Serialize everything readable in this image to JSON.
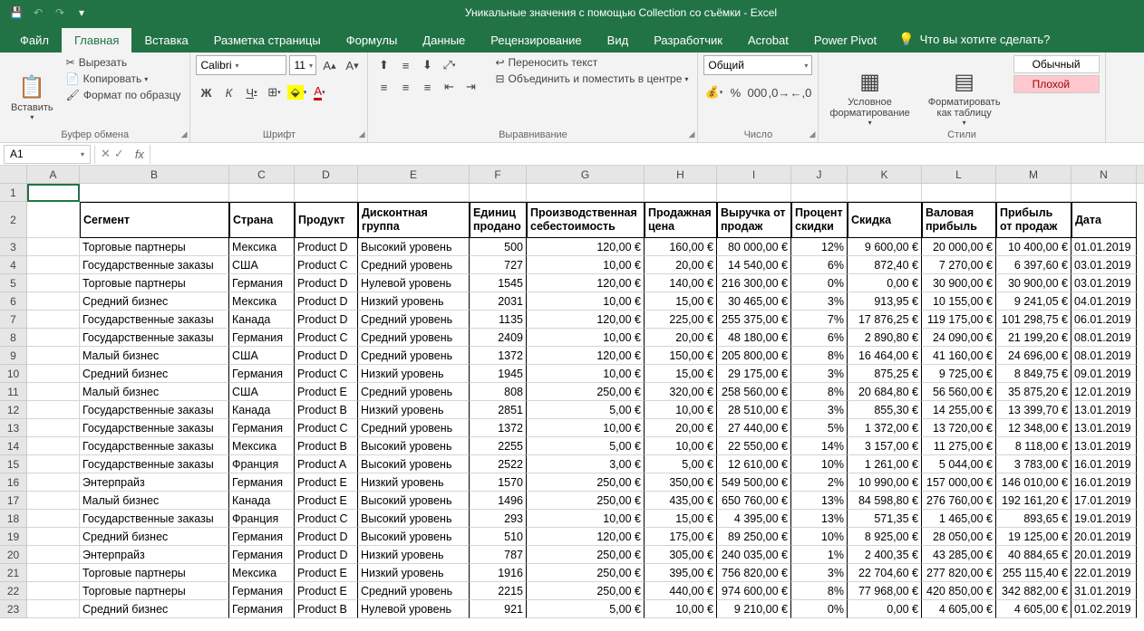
{
  "title": "Уникальные значения с помощью Collection со съёмки  -  Excel",
  "tabs": [
    "Файл",
    "Главная",
    "Вставка",
    "Разметка страницы",
    "Формулы",
    "Данные",
    "Рецензирование",
    "Вид",
    "Разработчик",
    "Acrobat",
    "Power Pivot"
  ],
  "tell_me": "Что вы хотите сделать?",
  "clipboard": {
    "paste": "Вставить",
    "cut": "Вырезать",
    "copy": "Копировать",
    "format_painter": "Формат по образцу",
    "label": "Буфер обмена"
  },
  "font": {
    "name": "Calibri",
    "size": "11",
    "label": "Шрифт"
  },
  "alignment": {
    "wrap": "Переносить текст",
    "merge": "Объединить и поместить в центре",
    "label": "Выравнивание"
  },
  "number": {
    "format": "Общий",
    "label": "Число"
  },
  "styles": {
    "conditional": "Условное\nформатирование",
    "as_table": "Форматировать\nкак таблицу",
    "normal": "Обычный",
    "bad": "Плохой",
    "label": "Стили"
  },
  "name_box": "A1",
  "headers": [
    "Сегмент",
    "Страна",
    "Продукт",
    "Дисконтная группа",
    "Единиц продано",
    "Производственная себестоимость",
    "Продажная цена",
    "Выручка от продаж",
    "Процент скидки",
    "Скидка",
    "Валовая прибыль",
    "Прибыль от продаж",
    "Дата"
  ],
  "col_letters": [
    "A",
    "B",
    "C",
    "D",
    "E",
    "F",
    "G",
    "H",
    "I",
    "J",
    "K",
    "L",
    "M",
    "N"
  ],
  "rows": [
    {
      "n": 3,
      "d": [
        "Торговые партнеры",
        "Мексика",
        "Product D",
        "Высокий уровень",
        "500",
        "120,00 €",
        "160,00 €",
        "80 000,00 €",
        "12%",
        "9 600,00 €",
        "20 000,00 €",
        "10 400,00 €",
        "01.01.2019"
      ]
    },
    {
      "n": 4,
      "d": [
        "Государственные заказы",
        "США",
        "Product C",
        "Средний уровень",
        "727",
        "10,00 €",
        "20,00 €",
        "14 540,00 €",
        "6%",
        "872,40 €",
        "7 270,00 €",
        "6 397,60 €",
        "03.01.2019"
      ]
    },
    {
      "n": 5,
      "d": [
        "Торговые партнеры",
        "Германия",
        "Product D",
        "Нулевой уровень",
        "1545",
        "120,00 €",
        "140,00 €",
        "216 300,00 €",
        "0%",
        "0,00 €",
        "30 900,00 €",
        "30 900,00 €",
        "03.01.2019"
      ]
    },
    {
      "n": 6,
      "d": [
        "Средний бизнес",
        "Мексика",
        "Product D",
        "Низкий уровень",
        "2031",
        "10,00 €",
        "15,00 €",
        "30 465,00 €",
        "3%",
        "913,95 €",
        "10 155,00 €",
        "9 241,05 €",
        "04.01.2019"
      ]
    },
    {
      "n": 7,
      "d": [
        "Государственные заказы",
        "Канада",
        "Product D",
        "Средний уровень",
        "1135",
        "120,00 €",
        "225,00 €",
        "255 375,00 €",
        "7%",
        "17 876,25 €",
        "119 175,00 €",
        "101 298,75 €",
        "06.01.2019"
      ]
    },
    {
      "n": 8,
      "d": [
        "Государственные заказы",
        "Германия",
        "Product C",
        "Средний уровень",
        "2409",
        "10,00 €",
        "20,00 €",
        "48 180,00 €",
        "6%",
        "2 890,80 €",
        "24 090,00 €",
        "21 199,20 €",
        "08.01.2019"
      ]
    },
    {
      "n": 9,
      "d": [
        "Малый бизнес",
        "США",
        "Product D",
        "Средний уровень",
        "1372",
        "120,00 €",
        "150,00 €",
        "205 800,00 €",
        "8%",
        "16 464,00 €",
        "41 160,00 €",
        "24 696,00 €",
        "08.01.2019"
      ]
    },
    {
      "n": 10,
      "d": [
        "Средний бизнес",
        "Германия",
        "Product C",
        "Низкий уровень",
        "1945",
        "10,00 €",
        "15,00 €",
        "29 175,00 €",
        "3%",
        "875,25 €",
        "9 725,00 €",
        "8 849,75 €",
        "09.01.2019"
      ]
    },
    {
      "n": 11,
      "d": [
        "Малый бизнес",
        "США",
        "Product E",
        "Средний уровень",
        "808",
        "250,00 €",
        "320,00 €",
        "258 560,00 €",
        "8%",
        "20 684,80 €",
        "56 560,00 €",
        "35 875,20 €",
        "12.01.2019"
      ]
    },
    {
      "n": 12,
      "d": [
        "Государственные заказы",
        "Канада",
        "Product B",
        "Низкий уровень",
        "2851",
        "5,00 €",
        "10,00 €",
        "28 510,00 €",
        "3%",
        "855,30 €",
        "14 255,00 €",
        "13 399,70 €",
        "13.01.2019"
      ]
    },
    {
      "n": 13,
      "d": [
        "Государственные заказы",
        "Германия",
        "Product C",
        "Средний уровень",
        "1372",
        "10,00 €",
        "20,00 €",
        "27 440,00 €",
        "5%",
        "1 372,00 €",
        "13 720,00 €",
        "12 348,00 €",
        "13.01.2019"
      ]
    },
    {
      "n": 14,
      "d": [
        "Государственные заказы",
        "Мексика",
        "Product B",
        "Высокий уровень",
        "2255",
        "5,00 €",
        "10,00 €",
        "22 550,00 €",
        "14%",
        "3 157,00 €",
        "11 275,00 €",
        "8 118,00 €",
        "13.01.2019"
      ]
    },
    {
      "n": 15,
      "d": [
        "Государственные заказы",
        "Франция",
        "Product A",
        "Высокий уровень",
        "2522",
        "3,00 €",
        "5,00 €",
        "12 610,00 €",
        "10%",
        "1 261,00 €",
        "5 044,00 €",
        "3 783,00 €",
        "16.01.2019"
      ]
    },
    {
      "n": 16,
      "d": [
        "Энтерпрайз",
        "Германия",
        "Product E",
        "Низкий уровень",
        "1570",
        "250,00 €",
        "350,00 €",
        "549 500,00 €",
        "2%",
        "10 990,00 €",
        "157 000,00 €",
        "146 010,00 €",
        "16.01.2019"
      ]
    },
    {
      "n": 17,
      "d": [
        "Малый бизнес",
        "Канада",
        "Product E",
        "Высокий уровень",
        "1496",
        "250,00 €",
        "435,00 €",
        "650 760,00 €",
        "13%",
        "84 598,80 €",
        "276 760,00 €",
        "192 161,20 €",
        "17.01.2019"
      ]
    },
    {
      "n": 18,
      "d": [
        "Государственные заказы",
        "Франция",
        "Product C",
        "Высокий уровень",
        "293",
        "10,00 €",
        "15,00 €",
        "4 395,00 €",
        "13%",
        "571,35 €",
        "1 465,00 €",
        "893,65 €",
        "19.01.2019"
      ]
    },
    {
      "n": 19,
      "d": [
        "Средний бизнес",
        "Германия",
        "Product D",
        "Высокий уровень",
        "510",
        "120,00 €",
        "175,00 €",
        "89 250,00 €",
        "10%",
        "8 925,00 €",
        "28 050,00 €",
        "19 125,00 €",
        "20.01.2019"
      ]
    },
    {
      "n": 20,
      "d": [
        "Энтерпрайз",
        "Германия",
        "Product D",
        "Низкий уровень",
        "787",
        "250,00 €",
        "305,00 €",
        "240 035,00 €",
        "1%",
        "2 400,35 €",
        "43 285,00 €",
        "40 884,65 €",
        "20.01.2019"
      ]
    },
    {
      "n": 21,
      "d": [
        "Торговые партнеры",
        "Мексика",
        "Product E",
        "Низкий уровень",
        "1916",
        "250,00 €",
        "395,00 €",
        "756 820,00 €",
        "3%",
        "22 704,60 €",
        "277 820,00 €",
        "255 115,40 €",
        "22.01.2019"
      ]
    },
    {
      "n": 22,
      "d": [
        "Торговые партнеры",
        "Германия",
        "Product E",
        "Средний уровень",
        "2215",
        "250,00 €",
        "440,00 €",
        "974 600,00 €",
        "8%",
        "77 968,00 €",
        "420 850,00 €",
        "342 882,00 €",
        "31.01.2019"
      ]
    },
    {
      "n": 23,
      "d": [
        "Средний бизнес",
        "Германия",
        "Product B",
        "Нулевой уровень",
        "921",
        "5,00 €",
        "10,00 €",
        "9 210,00 €",
        "0%",
        "0,00 €",
        "4 605,00 €",
        "4 605,00 €",
        "01.02.2019"
      ]
    }
  ]
}
